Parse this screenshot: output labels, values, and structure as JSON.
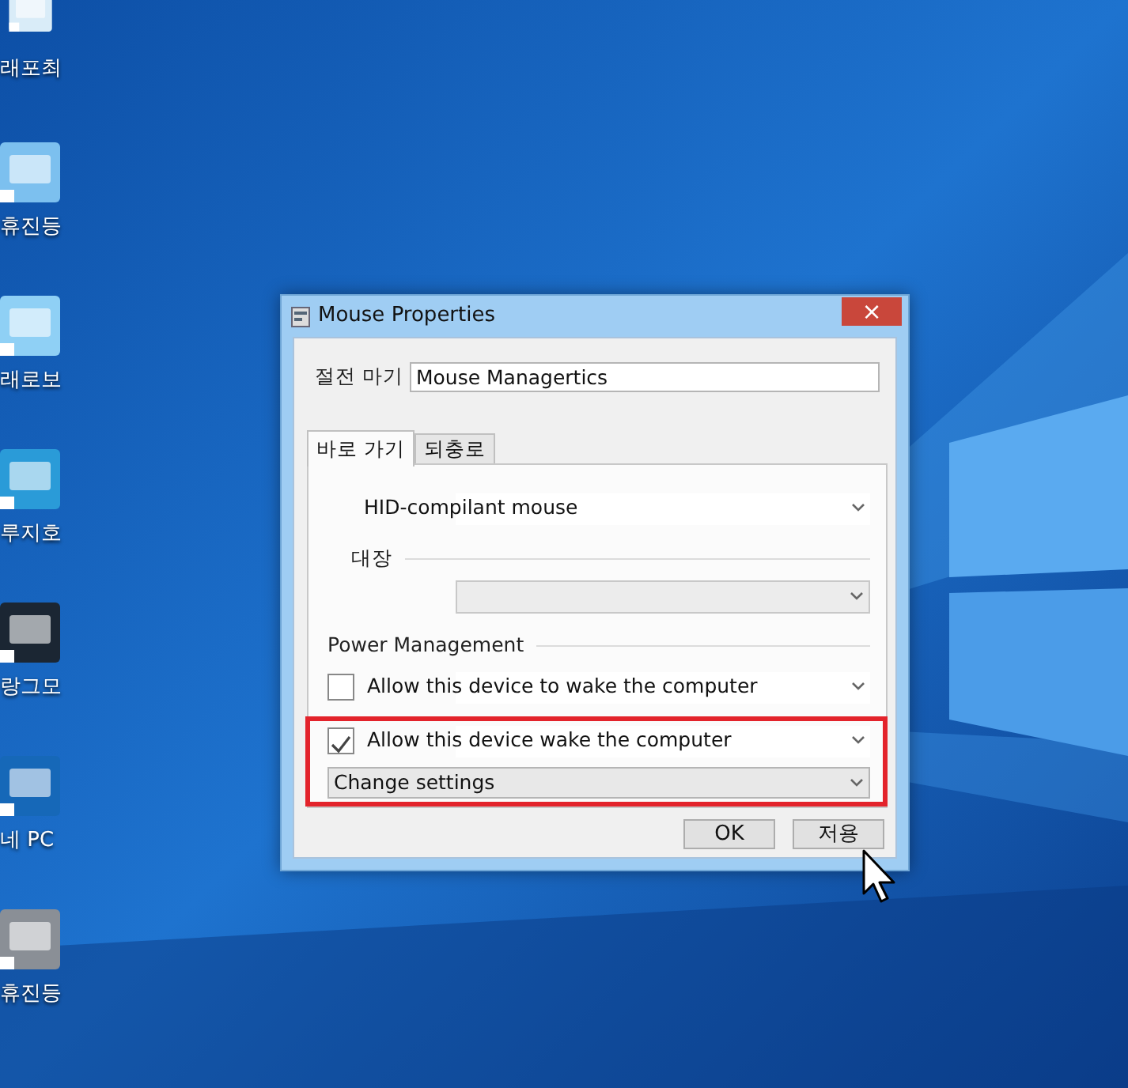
{
  "desktop_icons": [
    {
      "label": "래포최"
    },
    {
      "label": "휴진등"
    },
    {
      "label": "래로보"
    },
    {
      "label": "루지호"
    },
    {
      "label": "랑그모"
    },
    {
      "label": "네 PC"
    },
    {
      "label": "휴진등"
    }
  ],
  "dialog": {
    "title": "Mouse Properties",
    "close": "×",
    "name_label": "절전 마기",
    "name_value": "Mouse Managertics",
    "tabs": [
      {
        "label": "바로 가기",
        "selected": true
      },
      {
        "label": "되충로",
        "selected": false
      }
    ],
    "device_select": "HID-compilant mouse",
    "group_label": "대장",
    "power_label": "Power Management",
    "power_rows": [
      {
        "kind": "checkbox",
        "checked": false,
        "highlighted": false,
        "text": "Allow this device to wake the computer"
      },
      {
        "kind": "checkbox",
        "checked": true,
        "highlighted": true,
        "text": "Allow this device wake the computer"
      },
      {
        "kind": "dropdown",
        "highlighted": true,
        "text": "Change settings"
      }
    ],
    "buttons": [
      "OK",
      "저용"
    ]
  }
}
